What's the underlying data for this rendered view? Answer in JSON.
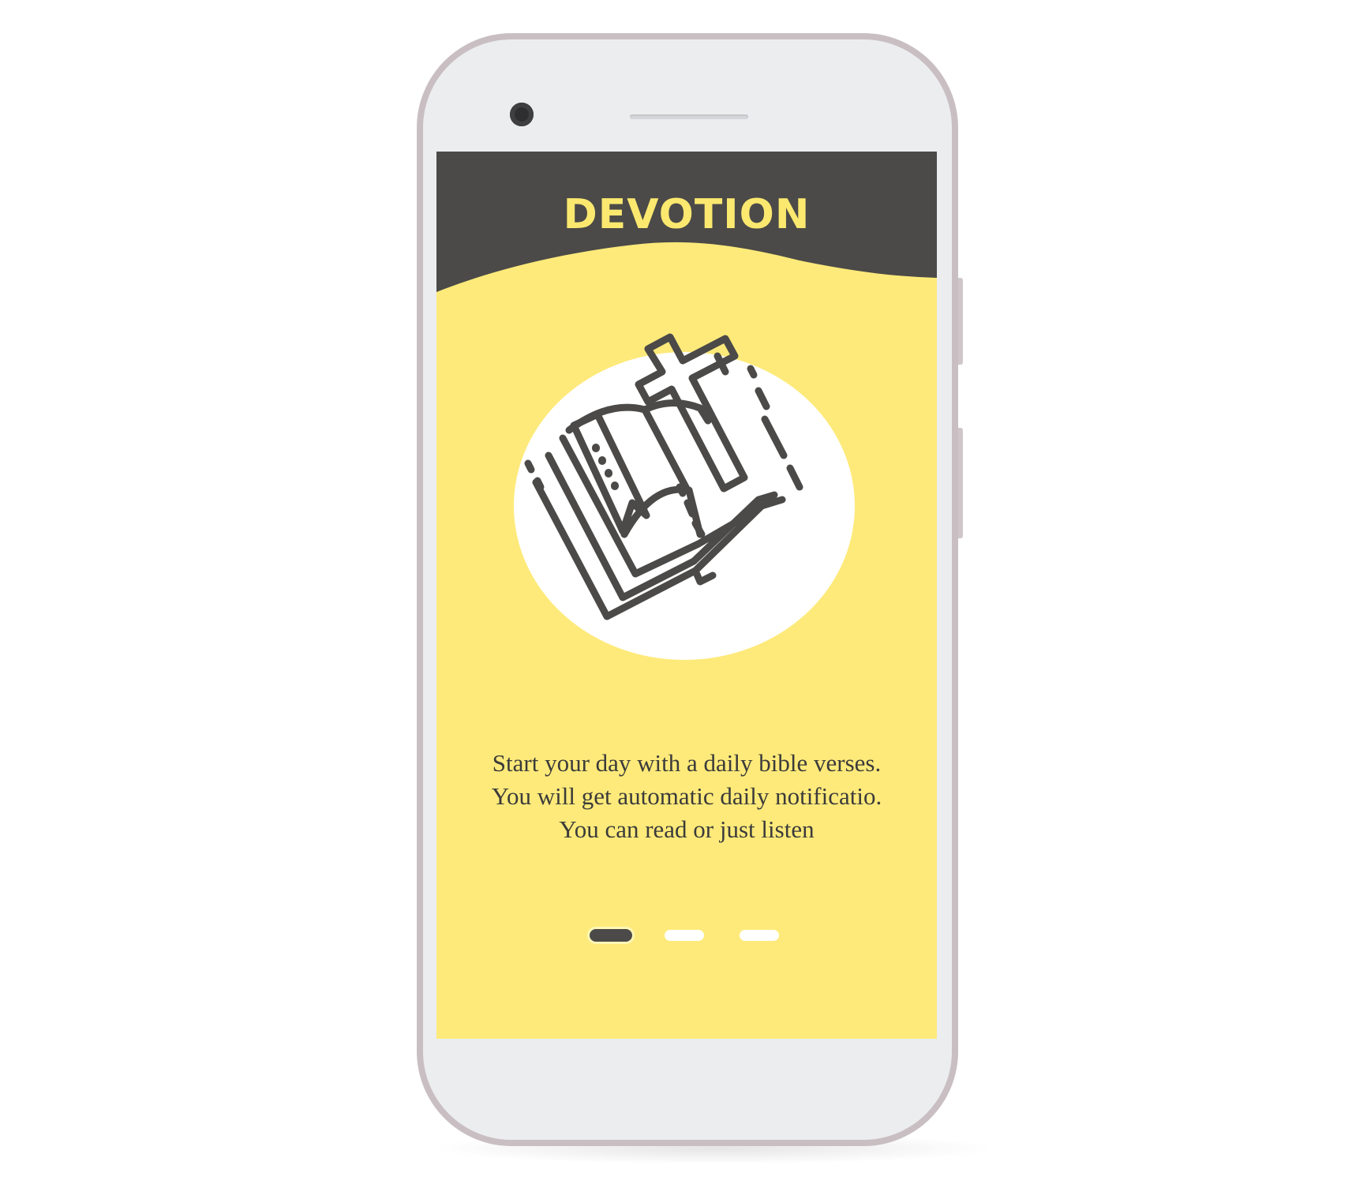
{
  "app": {
    "title": "DEVOTION"
  },
  "onboarding": {
    "illustration": "bible-cross-icon",
    "description_lines": [
      "Start your day with a daily bible verses.",
      "You will get automatic daily notificatio.",
      "You can read or just listen"
    ],
    "pager": {
      "total_pages": 3,
      "current_page": 1
    }
  },
  "colors": {
    "header": "#4b4a48",
    "accent_yellow": "#feea7a",
    "title_text": "#fbe86f",
    "body_text": "#3b3b3b",
    "phone_body": "#ecedef"
  }
}
